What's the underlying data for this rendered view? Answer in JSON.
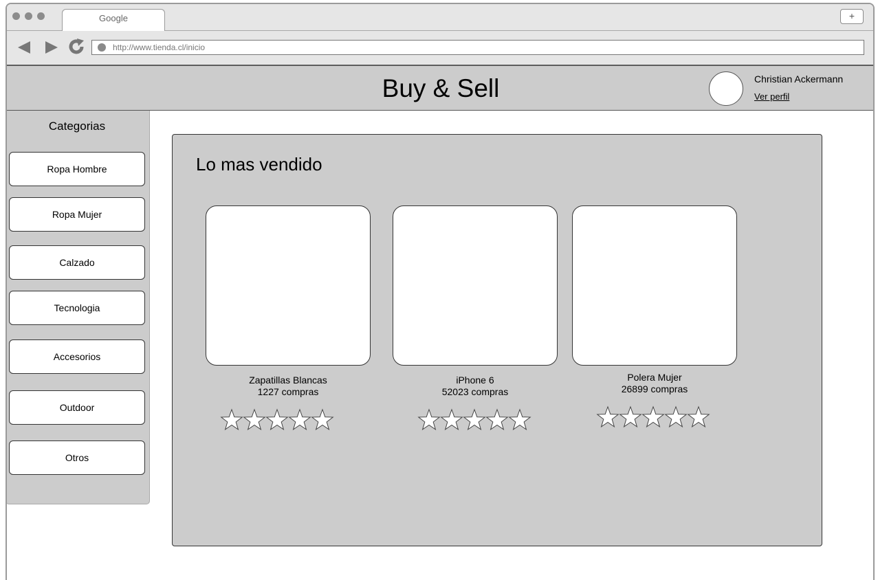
{
  "browser": {
    "tab_title": "Google",
    "new_tab_label": "+",
    "url": "http://www.tienda.cl/inicio"
  },
  "header": {
    "brand": "Buy & Sell",
    "user_name": "Christian Ackermann",
    "profile_link": "Ver perfil"
  },
  "sidebar": {
    "title": "Categorias",
    "items": [
      {
        "label": "Ropa Hombre"
      },
      {
        "label": "Ropa Mujer"
      },
      {
        "label": "Calzado"
      },
      {
        "label": "Tecnologia"
      },
      {
        "label": "Accesorios"
      },
      {
        "label": "Outdoor"
      },
      {
        "label": "Otros"
      }
    ]
  },
  "main": {
    "title": "Lo mas vendido",
    "products": [
      {
        "name": "Zapatillas Blancas",
        "count": "1227 compras",
        "rating": 0,
        "rating_max": 5
      },
      {
        "name": "iPhone 6",
        "count": "52023 compras",
        "rating": 0,
        "rating_max": 5
      },
      {
        "name": "Polera Mujer",
        "count": "26899 compras",
        "rating": 0,
        "rating_max": 5
      }
    ]
  },
  "icons": {
    "back": "back-arrow-icon",
    "forward": "forward-arrow-icon",
    "reload": "reload-icon",
    "star": "star-outline-icon"
  },
  "colors": {
    "panel_gray": "#cccccc",
    "chrome_gray": "#e6e6e6"
  }
}
